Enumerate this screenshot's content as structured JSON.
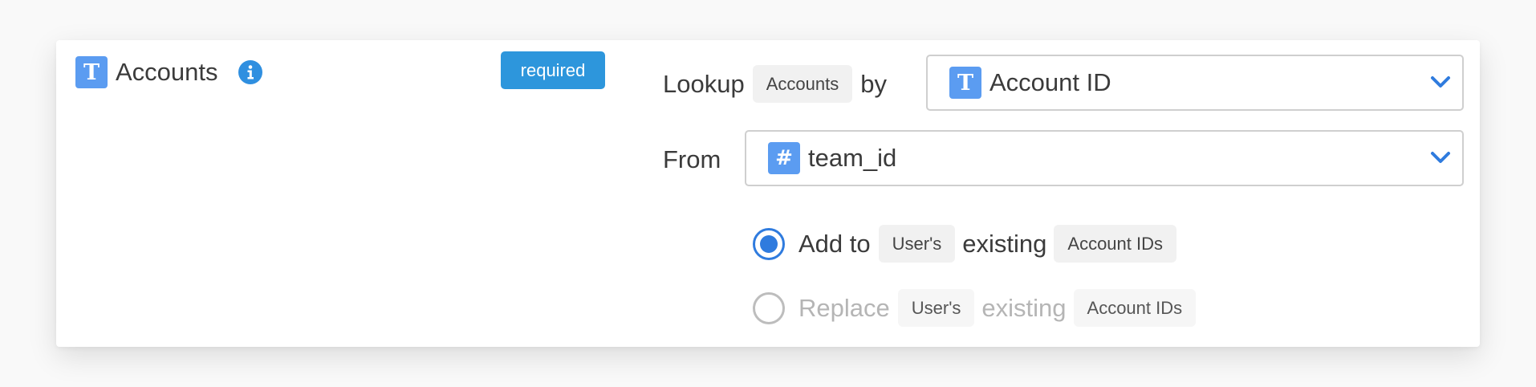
{
  "field": {
    "name": "Accounts",
    "type_icon_glyph": "T",
    "required_label": "required"
  },
  "lookup": {
    "label": "Lookup",
    "object_chip": "Accounts",
    "by_label": "by",
    "select_icon_glyph": "T",
    "select_value": "Account ID"
  },
  "from": {
    "label": "From",
    "select_icon_glyph": "#",
    "select_value": "team_id"
  },
  "options": [
    {
      "verb": "Add to",
      "subject_chip": "User's",
      "middle": "existing",
      "target_chip": "Account IDs",
      "selected": true
    },
    {
      "verb": "Replace",
      "subject_chip": "User's",
      "middle": "existing",
      "target_chip": "Account IDs",
      "selected": false
    }
  ],
  "colors": {
    "accent": "#2f7bde",
    "type_icon": "#5b9cf1",
    "badge": "#2d96dc"
  },
  "icons": [
    "text-type-icon",
    "info-icon",
    "chevron-down-icon",
    "number-type-icon",
    "radio-icon"
  ]
}
